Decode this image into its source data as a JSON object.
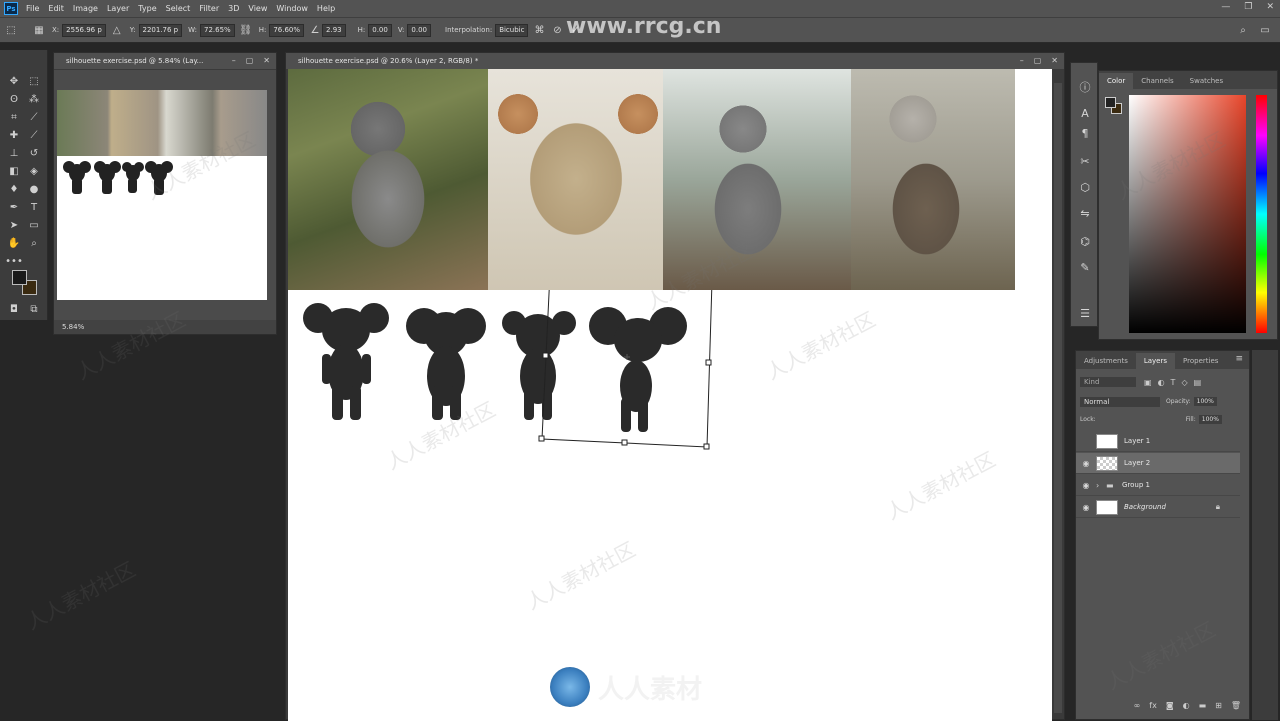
{
  "app": {
    "logo": "Ps",
    "menu": [
      "File",
      "Edit",
      "Image",
      "Layer",
      "Type",
      "Select",
      "Filter",
      "3D",
      "View",
      "Window",
      "Help"
    ],
    "window_controls": [
      "—",
      "❐",
      "✕"
    ]
  },
  "options_bar": {
    "x_label": "X:",
    "x_value": "2556.96 p",
    "y_label": "Y:",
    "y_value": "2201.76 p",
    "w_label": "W:",
    "w_value": "72.65%",
    "h_label": "H:",
    "h_value": "76.60%",
    "angle_value": "2.93",
    "hskew_label": "H:",
    "hskew_value": "0.00",
    "vskew_label": "V:",
    "vskew_value": "0.00",
    "interpolation_label": "Interpolation:",
    "interpolation_value": "Bicubic",
    "search_icon": "search-icon"
  },
  "nav_window": {
    "title": "silhouette exercise.psd @ 5.84% (Lay...",
    "zoom": "5.84%"
  },
  "main_window": {
    "title": "silhouette exercise.psd @ 20.6% (Layer 2, RGB/8) *"
  },
  "color_panel": {
    "tabs": [
      "Color",
      "Channels",
      "Swatches"
    ],
    "active_tab": "Color",
    "hue_color": "#e8452a"
  },
  "layers_panel": {
    "tabs": [
      "Adjustments",
      "Layers",
      "Properties"
    ],
    "active_tab": "Layers",
    "filter_placeholder": "Kind",
    "blend_mode": "Normal",
    "opacity_label": "Opacity:",
    "opacity_value": "100%",
    "lock_label": "Lock:",
    "fill_label": "Fill:",
    "fill_value": "100%",
    "layers": [
      {
        "name": "Layer 1",
        "visible": false,
        "selected": false
      },
      {
        "name": "Layer 2",
        "visible": true,
        "selected": true
      },
      {
        "name": "Group 1",
        "visible": true,
        "selected": false
      },
      {
        "name": "Background",
        "visible": true,
        "selected": false
      }
    ]
  },
  "watermark": {
    "top": "www.rrcg.cn",
    "bottom": "人人素材",
    "tile": "人人素材社区"
  }
}
